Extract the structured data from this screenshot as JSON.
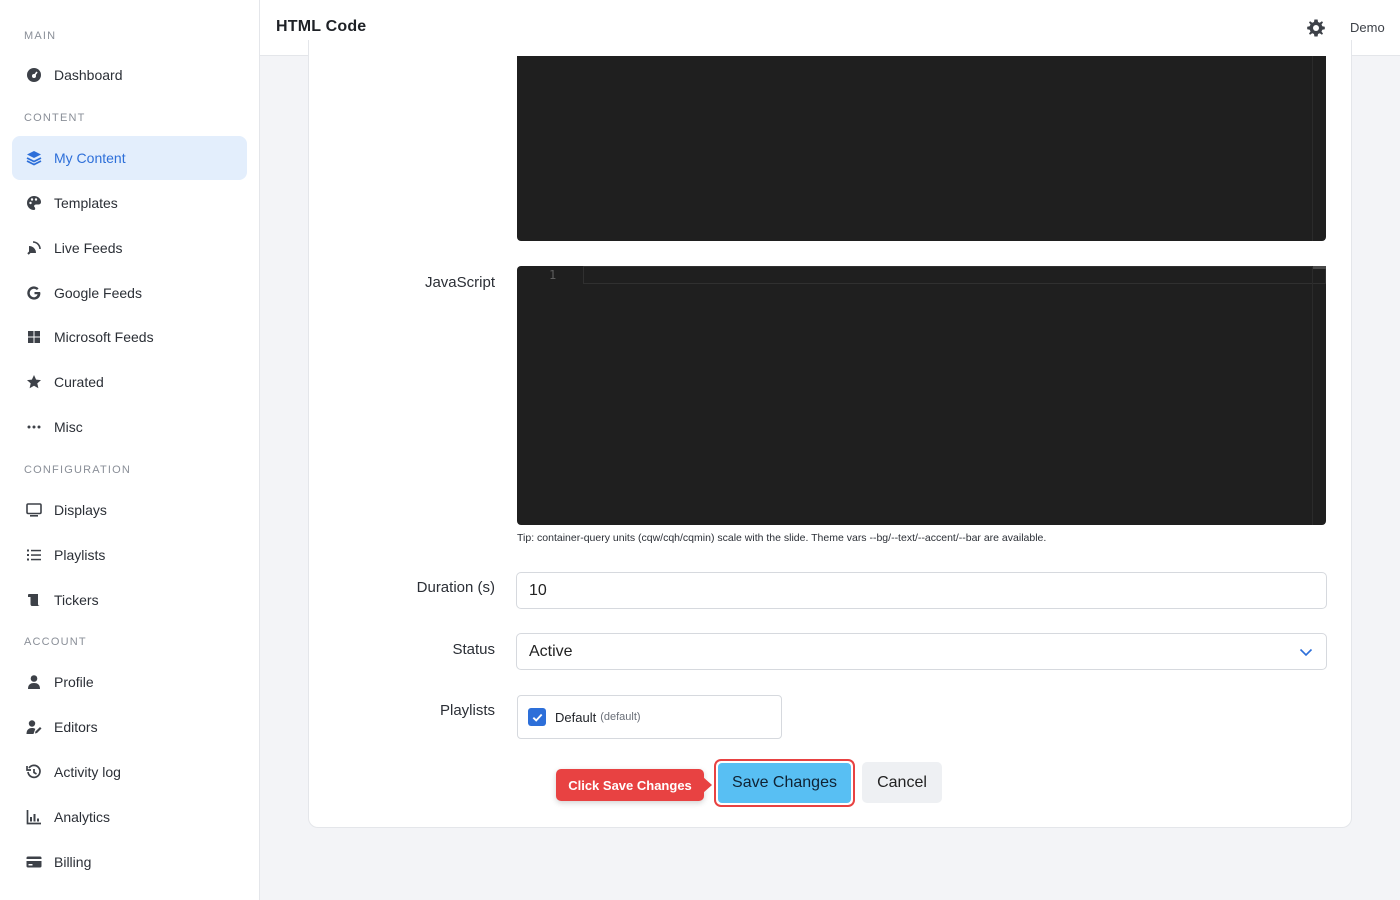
{
  "sidebar": {
    "sections": {
      "main": "MAIN",
      "content": "CONTENT",
      "configuration": "CONFIGURATION",
      "account": "ACCOUNT"
    },
    "items": {
      "dashboard": "Dashboard",
      "my_content": "My Content",
      "templates": "Templates",
      "live_feeds": "Live Feeds",
      "google_feeds": "Google Feeds",
      "microsoft_feeds": "Microsoft Feeds",
      "curated": "Curated",
      "misc": "Misc",
      "displays": "Displays",
      "playlists": "Playlists",
      "tickers": "Tickers",
      "profile": "Profile",
      "editors": "Editors",
      "activity_log": "Activity log",
      "analytics": "Analytics",
      "billing": "Billing"
    },
    "active_item": "My Content"
  },
  "topbar": {
    "title": "HTML Code",
    "user": "Demo",
    "settings_icon": "gear-icon"
  },
  "form": {
    "javascript_label": "JavaScript",
    "javascript_line_number": "1",
    "tip": "Tip: container-query units (cqw/cqh/cqmin) scale with the slide. Theme vars --bg/--text/--accent/--bar are available.",
    "duration_label": "Duration (s)",
    "duration_value": "10",
    "status_label": "Status",
    "status_value": "Active",
    "playlists_label": "Playlists",
    "playlist_name": "Default",
    "playlist_default_tag": "(default)",
    "playlist_checked": true
  },
  "actions": {
    "save_label": "Save Changes",
    "cancel_label": "Cancel",
    "tooltip": "Click Save Changes"
  },
  "colors": {
    "accent": "#2d6fd9",
    "save_button": "#58bff3",
    "highlight": "#e84242",
    "editor_bg": "#1f1f1f"
  }
}
